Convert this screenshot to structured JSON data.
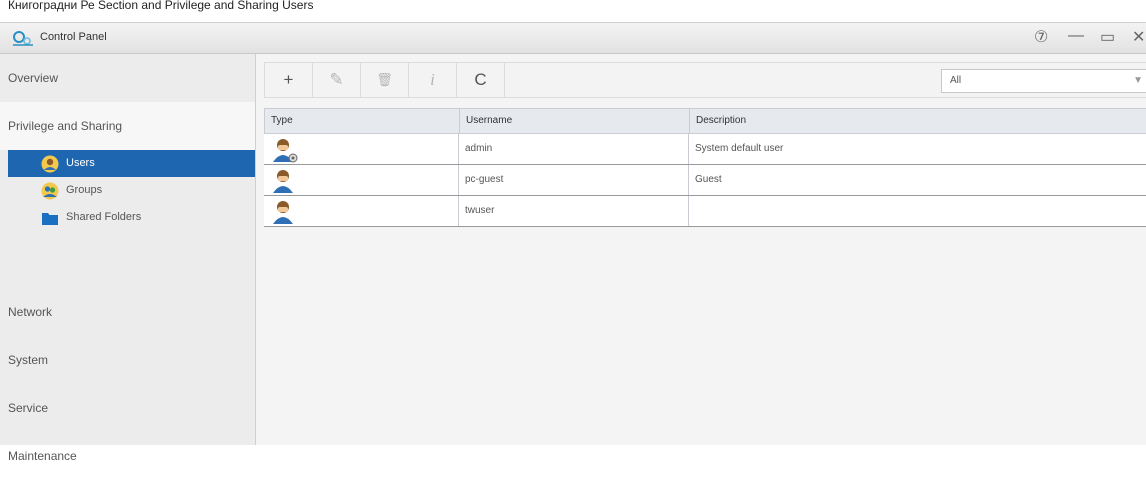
{
  "caption": "Книгоградни Ре Section and Privilege and Sharing Users",
  "window": {
    "title": "Control Panel",
    "help_glyph": "⑦",
    "minimize_glyph": "—",
    "maximize_glyph": "▭",
    "close_glyph": "✕"
  },
  "sidebar": {
    "sections": [
      {
        "label": "Overview"
      },
      {
        "label": "Privilege and Sharing"
      },
      {
        "label": "Network"
      },
      {
        "label": "System"
      },
      {
        "label": "Service"
      },
      {
        "label": "Maintenance"
      }
    ],
    "sub_items": [
      {
        "label": "Users",
        "icon": "user-icon",
        "selected": true
      },
      {
        "label": "Groups",
        "icon": "groups-icon",
        "selected": false
      },
      {
        "label": "Shared Folders",
        "icon": "folder-icon",
        "selected": false
      }
    ]
  },
  "toolbar": {
    "add_glyph": "+",
    "edit_glyph": "✎",
    "delete_glyph": "🗑",
    "info_glyph": "i",
    "refresh_glyph": "C",
    "filter_value": "All"
  },
  "table": {
    "columns": [
      "Type",
      "Username",
      "Description"
    ],
    "rows": [
      {
        "type_icon": "admin-user-icon",
        "username": "admin",
        "description": "System default user"
      },
      {
        "type_icon": "user-icon",
        "username": "pc-guest",
        "description": "Guest"
      },
      {
        "type_icon": "user-icon",
        "username": "twuser",
        "description": ""
      }
    ]
  },
  "colors": {
    "selected_bg": "#1f66b1",
    "sidebar_bg": "#ececec",
    "table_header_bg": "#e6e9ee"
  }
}
